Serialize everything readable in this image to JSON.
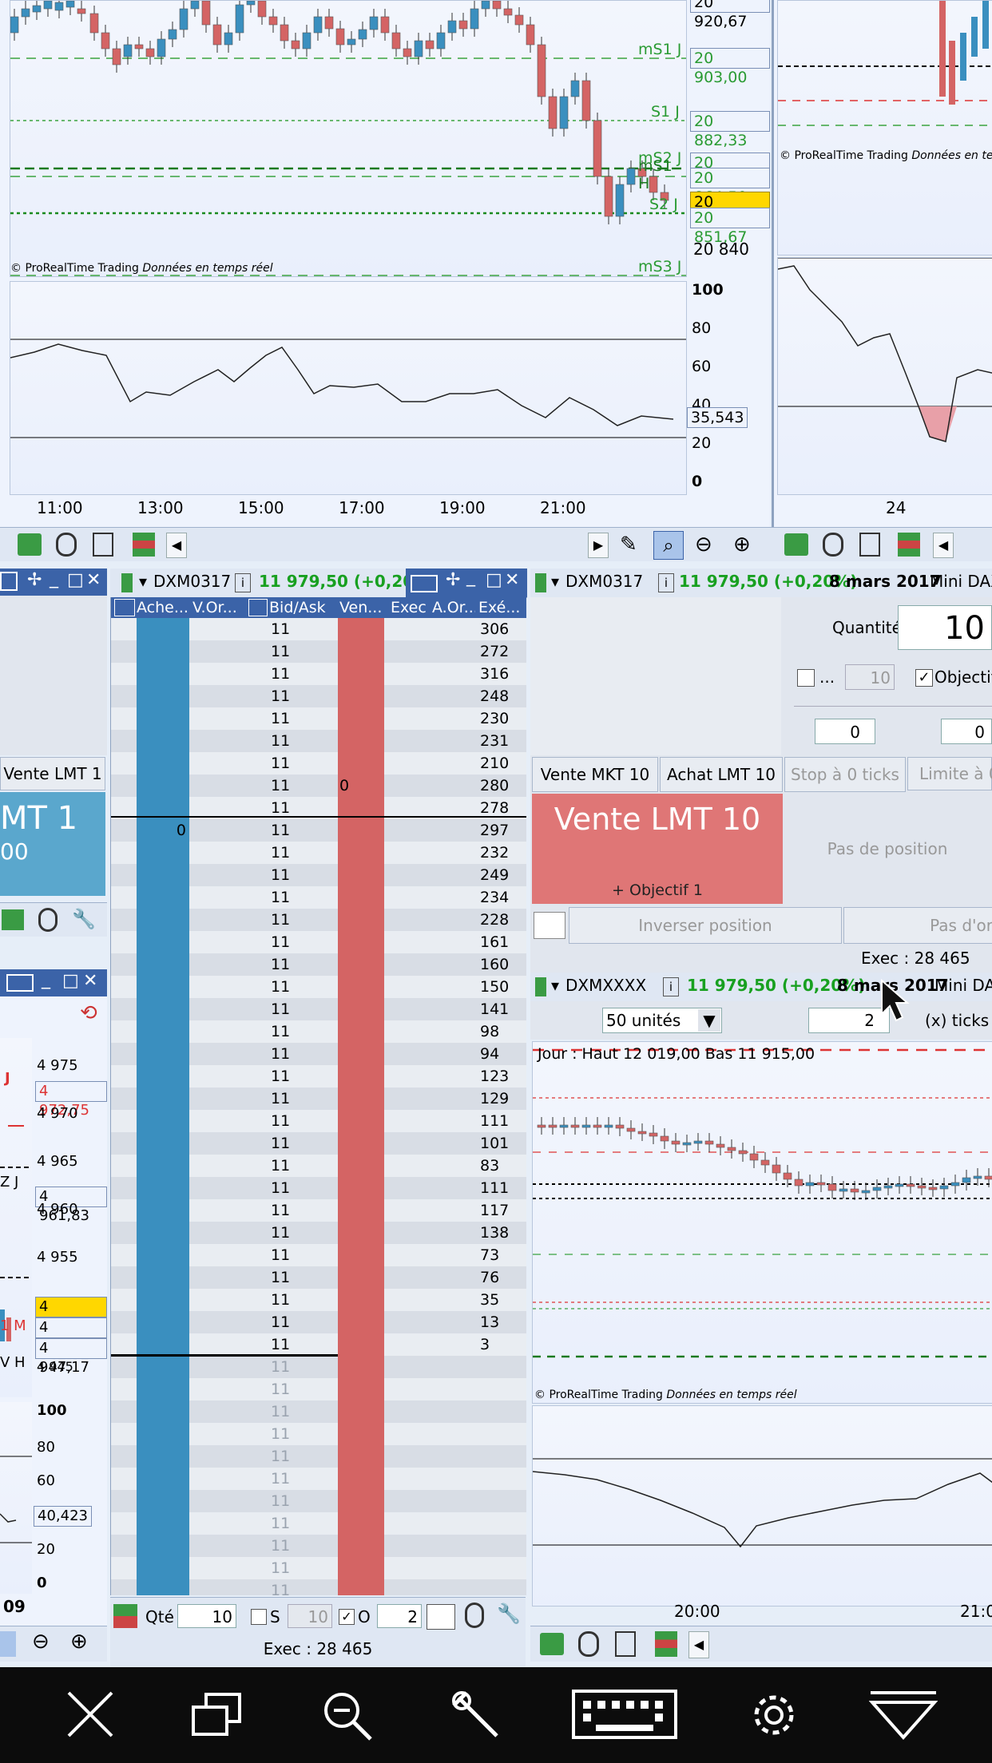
{
  "top_chart_left": {
    "levels": [
      {
        "name": "mS1 J",
        "value": "20 903,00",
        "color": "#2a9b33"
      },
      {
        "name": "S1 J",
        "value": "20 882,33",
        "color": "#2a9b33"
      },
      {
        "name": "mS2 J",
        "value": "20 867,00",
        "color": "#2a9b33"
      },
      {
        "name": "mS1 H",
        "value": "20 864,50",
        "color": "#2a9b33"
      },
      {
        "name": "S2 J",
        "value": "20 851,67",
        "color": "#2a9b33"
      },
      {
        "name": "mS3 J",
        "value": "",
        "color": "#2a9b33"
      }
    ],
    "current_price": "20 856,00",
    "tick_20840": "20 840",
    "tick_top": "20 920,67",
    "watermark_brand": "© ProRealTime Trading",
    "watermark_text": "Données en temps réel",
    "osc_ticks": [
      "100",
      "80",
      "60",
      "40",
      "20",
      "0"
    ],
    "osc_value": "35,543",
    "time_ticks": [
      "11:00",
      "13:00",
      "15:00",
      "17:00",
      "19:00",
      "21:00"
    ]
  },
  "top_chart_right": {
    "watermark_brand": "© ProRealTime Trading",
    "watermark_text": "Données en temps réel",
    "time_tick": "24"
  },
  "left_panel": {
    "sell_btn_label": "Vente LMT 1",
    "big_label": "MT 1",
    "big_sub": "00",
    "ticks": [
      "4 975",
      "4 970",
      "4 965",
      "4 960",
      "4 955",
      "4 945"
    ],
    "boxes": [
      "4 972,75",
      "4 961,83",
      "4 950,50",
      "4 949,00",
      "4 947,17"
    ],
    "frag_j": "J",
    "frag_zj": "Z J",
    "frag_m": "1 M",
    "frag_h": "V H",
    "osc_ticks": [
      "100",
      "80",
      "60",
      "20",
      "0"
    ],
    "osc_value": "40,423",
    "time_tick": "09"
  },
  "orderbook": {
    "symbol": "DXM0317",
    "price": "11 979,50 (+0,20%)",
    "columns": [
      "Ache...",
      "V.Or...",
      "Bid/Ask",
      "Ven...",
      "Exec",
      "A.Or...",
      "Exé..."
    ],
    "rows": [
      {
        "price": "11 947,...",
        "exe": "306"
      },
      {
        "price": "11 946,...",
        "exe": "272"
      },
      {
        "price": "11 945,...",
        "exe": "316"
      },
      {
        "price": "11 944,...",
        "exe": "248"
      },
      {
        "price": "11 943,...",
        "exe": "230"
      },
      {
        "price": "11 942,...",
        "exe": "231"
      },
      {
        "price": "11 941,...",
        "exe": "210"
      },
      {
        "price": "11 940,...",
        "exe": "280",
        "sellq": "0"
      },
      {
        "price": "11 939,...",
        "exe": "278"
      },
      {
        "price": "11 938,...",
        "exe": "297",
        "buyq": "0"
      },
      {
        "price": "11 937,...",
        "exe": "232"
      },
      {
        "price": "11 936,...",
        "exe": "249"
      },
      {
        "price": "11 935,...",
        "exe": "234"
      },
      {
        "price": "11 934,...",
        "exe": "228"
      },
      {
        "price": "11 933,...",
        "exe": "161"
      },
      {
        "price": "11 932,...",
        "exe": "160"
      },
      {
        "price": "11 931,...",
        "exe": "150"
      },
      {
        "price": "11 930,...",
        "exe": "141"
      },
      {
        "price": "11 929,...",
        "exe": "98"
      },
      {
        "price": "11 928,...",
        "exe": "94"
      },
      {
        "price": "11 927,...",
        "exe": "123"
      },
      {
        "price": "11 926,...",
        "exe": "129"
      },
      {
        "price": "11 925,...",
        "exe": "111"
      },
      {
        "price": "11 924,...",
        "exe": "101"
      },
      {
        "price": "11 923,...",
        "exe": "83"
      },
      {
        "price": "11 922,...",
        "exe": "111"
      },
      {
        "price": "11 921,...",
        "exe": "117"
      },
      {
        "price": "11 920,...",
        "exe": "138"
      },
      {
        "price": "11 919,...",
        "exe": "73"
      },
      {
        "price": "11 918,...",
        "exe": "76"
      },
      {
        "price": "11 917,...",
        "exe": "35"
      },
      {
        "price": "11 916,...",
        "exe": "13"
      },
      {
        "price": "11 915,...",
        "exe": "3"
      },
      {
        "price": "11 914,...",
        "exe": ""
      },
      {
        "price": "11 913,...",
        "exe": ""
      },
      {
        "price": "11 912,...",
        "exe": ""
      },
      {
        "price": "11 911,...",
        "exe": ""
      },
      {
        "price": "11 910,...",
        "exe": ""
      },
      {
        "price": "11 909,...",
        "exe": ""
      },
      {
        "price": "11 908,...",
        "exe": ""
      },
      {
        "price": "11 907,...",
        "exe": ""
      },
      {
        "price": "11 906,...",
        "exe": ""
      },
      {
        "price": "11 905,...",
        "exe": ""
      },
      {
        "price": "11 904,...",
        "exe": ""
      }
    ],
    "footer": {
      "qty_label": "Qté",
      "qty_value": "10",
      "s_label": "S",
      "s_value": "10",
      "o_label": "O",
      "o_value": "2",
      "exec": "Exec : 28 465"
    }
  },
  "order_ticket": {
    "symbol": "DXM0317",
    "price": "11 979,50 (+0,20%)",
    "date": "8 mars 2017",
    "instrument": "Mini DAX",
    "qty_label": "Quantité",
    "qty_value": "10",
    "check_label": "...",
    "check_value": "10",
    "objectif_label": "Objectif",
    "spin1": "0",
    "spin2": "0",
    "btn_vente_mkt": "Vente MKT 10",
    "btn_achat_lmt": "Achat LMT 10",
    "btn_stop": "Stop à 0 ticks",
    "btn_limite": "Limite à 0",
    "big_order": "Vente LMT 10",
    "big_order_sub": "+ Objectif 1",
    "position": "Pas de position",
    "inverse": "Inverser position",
    "pas_dor": "Pas d'or",
    "exec": "Exec : 28 465"
  },
  "bottom_right_chart": {
    "symbol": "DXMXXXX",
    "price": "11 979,50 (+0,20%)",
    "date": "8 mars 2017",
    "instrument": "Mini DAX",
    "units": "50 unités",
    "ticks_value": "2",
    "ticks_label": "(x) ticks",
    "day_info": "Jour : Haut 12 019,00 Bas 11 915,00",
    "watermark_brand": "© ProRealTime Trading",
    "watermark_text": "Données en temps réel",
    "time_ticks": [
      "20:00",
      "21:0"
    ]
  },
  "taskbar": {
    "icons": [
      "close-icon",
      "windows-icon",
      "zoom-out-icon",
      "wrench-icon",
      "keyboard-icon",
      "gear-icon",
      "dropdown-icon"
    ]
  }
}
